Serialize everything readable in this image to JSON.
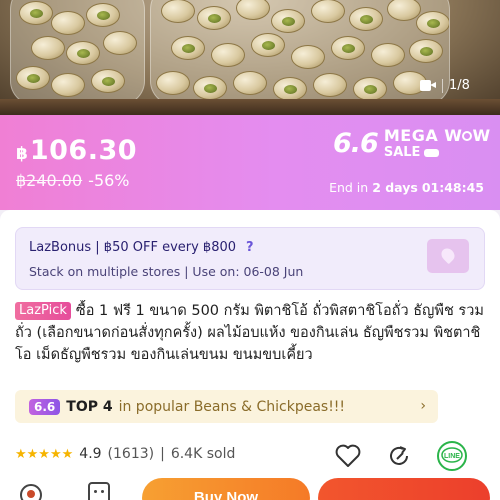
{
  "media": {
    "counter": "1/8",
    "video_icon": "video-camera-icon"
  },
  "price": {
    "currency": "฿",
    "amount": "106.30",
    "original": "฿240.00",
    "discount": "-56%"
  },
  "campaign": {
    "number": "6.6",
    "line1": "MEGA W",
    "line1_end": "W",
    "line2": "SALE"
  },
  "countdown": {
    "prefix": "End in",
    "days": "2 days",
    "time": "01:48:45"
  },
  "bonus": {
    "line1": "LazBonus | ฿50 OFF every ฿800",
    "help": "?",
    "line2": "Stack on multiple stores | Use on: 06-08 Jun"
  },
  "product": {
    "badge": "LazPick",
    "title": "ซื้อ 1 ฟรี 1 ขนาด 500 กรัม พิตาชิโอ้ ถั่วพิสตาชิโอถั่ว ธัญพืช รวมถั่ว (เลือกขนาดก่อนสั่งทุกครั้ง) ผลไม้อบแห้ง ของกินเล่น ธัญพืชรวม พิชตาชิโอ เม็ดธัญพืชรวม ของกินเล่นขนม ขนมขบเคี้ยว"
  },
  "ranking": {
    "chip": "6.6",
    "rank": "TOP 4",
    "category": "in popular Beans & Chickpeas!!!",
    "arrow": "›"
  },
  "rating": {
    "stars": "★★★★★",
    "score": "4.9",
    "count": "(1613)",
    "separator": "|",
    "sold": "6.4K sold"
  },
  "actions": {
    "line_label": "LINE"
  },
  "bottom": {
    "buy_now": "Buy Now"
  }
}
